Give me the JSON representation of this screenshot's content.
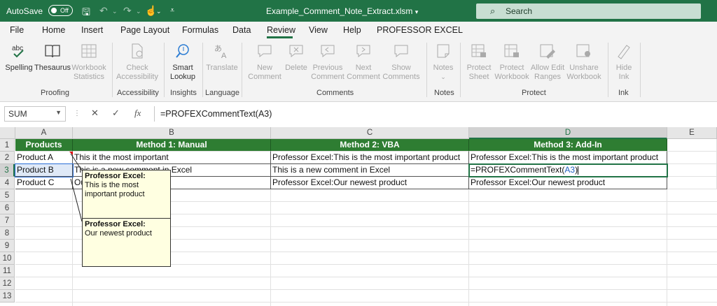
{
  "titlebar": {
    "autosave_label": "AutoSave",
    "autosave_state": "Off",
    "filename": "Example_Comment_Note_Extract.xlsm",
    "search_placeholder": "Search"
  },
  "menu": {
    "tabs": [
      "File",
      "Home",
      "Insert",
      "Page Layout",
      "Formulas",
      "Data",
      "Review",
      "View",
      "Help",
      "PROFESSOR EXCEL"
    ],
    "active_tab": "Review"
  },
  "ribbon": {
    "proofing": {
      "label": "Proofing",
      "spelling": "Spelling",
      "thesaurus": "Thesaurus",
      "wbstats_1": "Workbook",
      "wbstats_2": "Statistics"
    },
    "accessibility": {
      "label": "Accessibility",
      "check_1": "Check",
      "check_2": "Accessibility"
    },
    "insights": {
      "label": "Insights",
      "smart_1": "Smart",
      "smart_2": "Lookup"
    },
    "language": {
      "label": "Language",
      "translate": "Translate"
    },
    "comments": {
      "label": "Comments",
      "new_1": "New",
      "new_2": "Comment",
      "delete": "Delete",
      "prev_1": "Previous",
      "prev_2": "Comment",
      "next_1": "Next",
      "next_2": "Comment",
      "show_1": "Show",
      "show_2": "Comments"
    },
    "notes": {
      "label": "Notes",
      "notes": "Notes"
    },
    "protect": {
      "label": "Protect",
      "psheet_1": "Protect",
      "psheet_2": "Sheet",
      "pwb_1": "Protect",
      "pwb_2": "Workbook",
      "allow_1": "Allow Edit",
      "allow_2": "Ranges",
      "unshare_1": "Unshare",
      "unshare_2": "Workbook"
    },
    "ink": {
      "label": "Ink",
      "hide_1": "Hide",
      "hide_2": "Ink"
    }
  },
  "formula_bar": {
    "name_box": "SUM",
    "cancel": "✕",
    "enter": "✓",
    "fx": "fx",
    "formula": "=PROFEXCommentText(A3)"
  },
  "sheet": {
    "columns": [
      "A",
      "B",
      "C",
      "D",
      "E"
    ],
    "rows": [
      "1",
      "2",
      "3",
      "4",
      "5",
      "6",
      "7",
      "8",
      "9",
      "10",
      "11",
      "12",
      "13"
    ],
    "header_row": [
      "Products",
      "Method 1: Manual",
      "Method 2: VBA",
      "Method 3: Add-In"
    ],
    "data": [
      [
        "Product A",
        "This it the most important",
        "Professor Excel:This is the most important product",
        "Professor Excel:This is the most important product"
      ],
      [
        "Product B",
        "This is a new comment in Excel",
        "This is a new comment in Excel",
        "=PROFEXCommentText(A3)"
      ],
      [
        "Product C",
        "Our newest product",
        "Professor Excel:Our newest product",
        "Professor Excel:Our newest product"
      ]
    ],
    "editing_formula_prefix": "=PROFEXCommentText(",
    "editing_formula_ref": "A3",
    "editing_formula_suffix": ")"
  },
  "notes": [
    {
      "author": "Professor Excel:",
      "text": "This is the most important product"
    },
    {
      "author": "Professor Excel:",
      "text": "Our newest product"
    }
  ],
  "colors": {
    "excel_green": "#217346",
    "header_fill": "#2e7d32",
    "note_fill": "#ffffe1",
    "ref_blue": "#1f5fbf"
  }
}
